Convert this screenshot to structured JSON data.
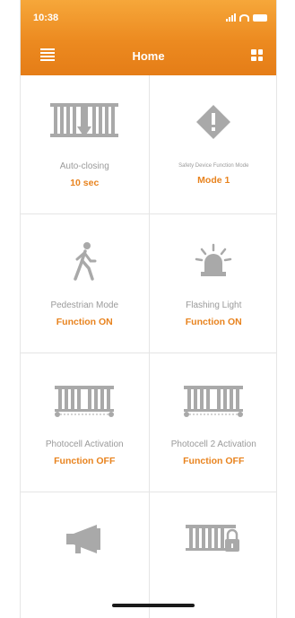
{
  "status_bar": {
    "time": "10:38"
  },
  "header": {
    "title": "Home"
  },
  "tiles": [
    {
      "label": "Auto-closing",
      "value": "10 sec",
      "icon": "gate-closing-icon"
    },
    {
      "label": "Safety Device Function Mode",
      "value": "Mode 1",
      "icon": "warning-diamond-icon"
    },
    {
      "label": "Pedestrian Mode",
      "value": "Function ON",
      "icon": "pedestrian-icon"
    },
    {
      "label": "Flashing Light",
      "value": "Function ON",
      "icon": "flashing-light-icon"
    },
    {
      "label": "Photocell Activation",
      "value": "Function OFF",
      "icon": "photocell-gate-icon"
    },
    {
      "label": "Photocell 2 Activation",
      "value": "Function OFF",
      "icon": "photocell-gate-icon"
    },
    {
      "label": "",
      "value": "",
      "icon": "megaphone-icon"
    },
    {
      "label": "",
      "value": "",
      "icon": "gate-lock-icon"
    }
  ],
  "colors": {
    "accent": "#ec8a20",
    "icon_gray": "#a9a9a9",
    "label_gray": "#9a9a9a"
  }
}
